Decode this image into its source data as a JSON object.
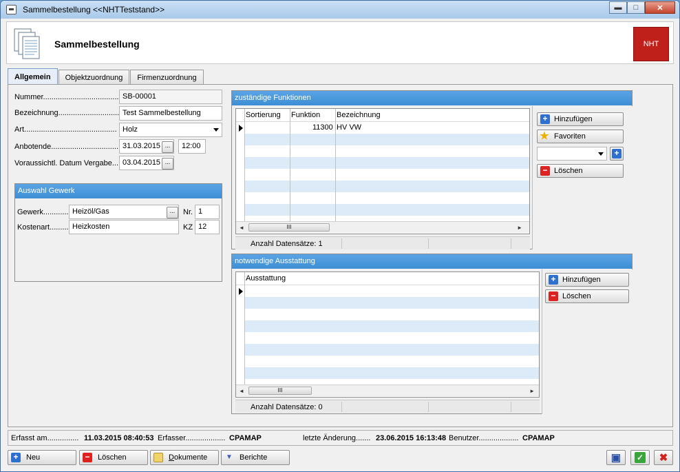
{
  "window": {
    "title": "Sammelbestellung  <<NHTTeststand>>",
    "controls": {
      "minimize": "▬",
      "maximize": "□",
      "close": "✕"
    }
  },
  "header": {
    "title": "Sammelbestellung",
    "logo_text": "NHT"
  },
  "tabs": [
    {
      "label": "Allgemein",
      "active": true
    },
    {
      "label": "Objektzuordnung",
      "active": false
    },
    {
      "label": "Firmenzuordnung",
      "active": false
    }
  ],
  "form": {
    "nummer": {
      "label": "Nummer......................................",
      "value": "SB-00001"
    },
    "bezeichnung": {
      "label": "Bezeichnung................................",
      "value": "Test Sammelbestellung"
    },
    "art": {
      "label": "Art............................................",
      "value": "Holz"
    },
    "anbotende": {
      "label": "Anbotende...................................",
      "date": "31.03.2015",
      "time": "12:00"
    },
    "vergabe": {
      "label": "Voraussichtl. Datum Vergabe.......",
      "date": "03.04.2015"
    },
    "ellipsis": "..."
  },
  "gewerk_group": {
    "title": "Auswahl Gewerk",
    "gewerk": {
      "label": "Gewerk............",
      "value": "Heizöl/Gas",
      "nr_label": "Nr.",
      "nr_value": "1"
    },
    "kostenart": {
      "label": "Kostenart.........",
      "value": "Heizkosten",
      "kz_label": "KZ",
      "kz_value": "12"
    }
  },
  "funktionen": {
    "title": "zuständige Funktionen",
    "columns": [
      "Sortierung",
      "Funktion",
      "Bezeichnung"
    ],
    "rows": [
      {
        "sortierung": "",
        "funktion": "11300",
        "bezeichnung": "HV VW"
      }
    ],
    "status": "Anzahl Datensätze: 1",
    "buttons": {
      "add": "Hinzufügen",
      "favorites": "Favoriten",
      "delete": "Löschen"
    },
    "favorites_select": "",
    "scroll_grip": "III"
  },
  "ausstattung": {
    "title": "notwendige Ausstattung",
    "columns": [
      "Ausstattung"
    ],
    "status": "Anzahl Datensätze: 0",
    "buttons": {
      "add": "Hinzufügen",
      "delete": "Löschen"
    },
    "scroll_grip": "III"
  },
  "footer": {
    "erfasst_label": "Erfasst am...............",
    "erfasst_value": "11.03.2015 08:40:53",
    "erfasser_label": "Erfasser...................",
    "erfasser_value": "CPAMAP",
    "aenderung_label": "letzte Änderung.......",
    "aenderung_value": "23.06.2015 16:13:48",
    "benutzer_label": "Benutzer...................",
    "benutzer_value": "CPAMAP"
  },
  "toolbar": {
    "neu": "Neu",
    "loeschen": "Löschen",
    "dokumente_underline": "D",
    "dokumente_rest": "okumente",
    "berichte": "Berichte"
  },
  "colors": {
    "accent_blue": "#3d8ed6",
    "logo_red": "#c0201a",
    "row_stripe": "#ddeaf7"
  }
}
